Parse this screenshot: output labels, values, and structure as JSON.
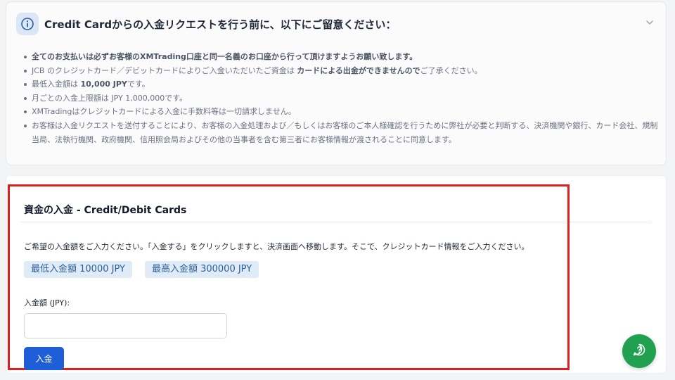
{
  "notice": {
    "title": "Credit Cardからの入金リクエストを行う前に、以下にご留意ください：",
    "rules": [
      "全てのお支払いは必ずお客様のXMTrading口座と同一名義のお口座から行って頂けますようお願い致します。",
      {
        "pre": "JCB のクレジットカード／デビットカードによりご入金いただいたご資金は ",
        "strong": "カードによる出金ができませんので",
        "post": "ご了承ください。"
      },
      {
        "pre": "最低入金額は ",
        "strong": "10,000 JPY",
        "post": "です。"
      },
      "月ごとの入金上限額は JPY 1,000,000です。",
      "XMTradingはクレジットカードによる入金に手数料等は一切請求しません。",
      "お客様は入金リクエストを送付することにより、お客様の入金処理および／もしくはお客様のご本人様確認を行うために弊社が必要と判断する、決済機関や銀行、カード会社、規制当局、法執行機関、政府機関、信用照会局およびその他の当事者を含む第三者にお客様情報が渡されることに同意します。"
    ]
  },
  "deposit": {
    "title": "資金の入金 - Credit/Debit Cards",
    "description": "ご希望の入金額をご入力ください。「入金する」をクリックしますと、決済画面へ移動します。そこで、クレジットカード情報をご入力ください。",
    "min_badge": "最低入金額 10000 JPY",
    "max_badge": "最高入金額 300000 JPY",
    "amount_label": "入金額 (JPY):",
    "amount_value": "",
    "submit_label": "入金"
  },
  "icons": {
    "notice": "info-icon",
    "collapse": "chevron-down-icon",
    "chat": "help-chat-icon"
  },
  "colors": {
    "primary_button": "#1e5ed8",
    "badge_bg": "#e0ebf8",
    "badge_text": "#2b5f97",
    "highlight_border": "#dc1f1f",
    "chat_button": "#21a050"
  }
}
